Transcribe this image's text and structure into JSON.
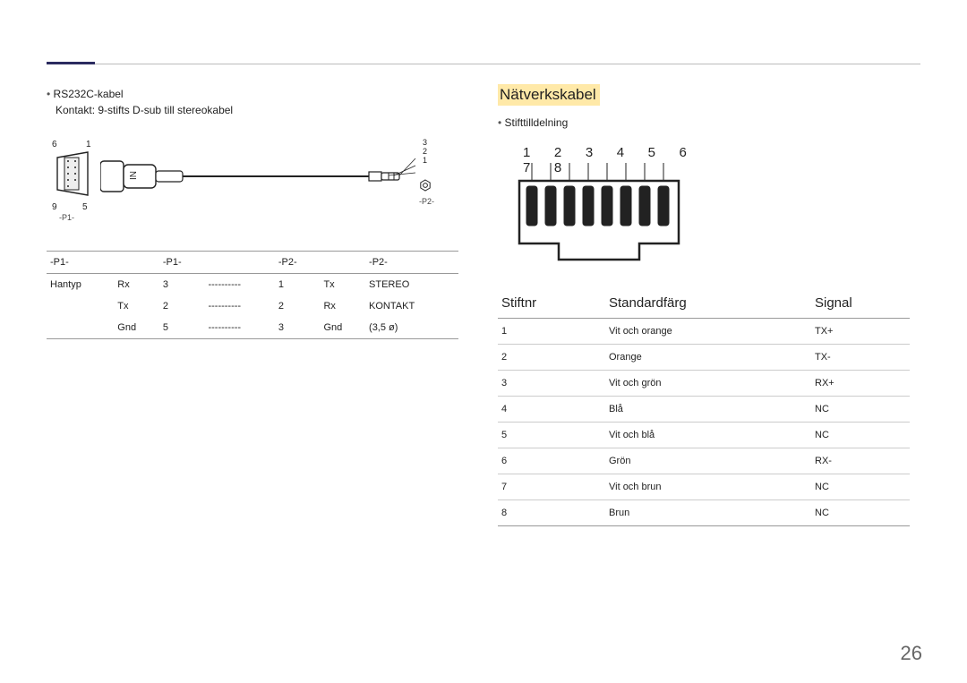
{
  "pageNumber": "26",
  "left": {
    "bullet": "RS232C-kabel",
    "sub": "Kontakt: 9-stifts D-sub till stereokabel",
    "dsub": {
      "tl": "6",
      "tr": "1",
      "bl": "9",
      "br": "5",
      "p1": "-P1-"
    },
    "jack": {
      "l3": "3",
      "l2": "2",
      "l1": "1",
      "p2": "-P2-"
    },
    "tableHeader": [
      "-P1-",
      "-P1-",
      "",
      "-P2-",
      "-P2-",
      ""
    ],
    "tableRows": [
      [
        "Hantyp",
        "Rx",
        "3",
        "----------",
        "1",
        "Tx",
        "STEREO"
      ],
      [
        "",
        "Tx",
        "2",
        "----------",
        "2",
        "Rx",
        "KONTAKT"
      ],
      [
        "",
        "Gnd",
        "5",
        "----------",
        "3",
        "Gnd",
        "(3,5 ø)"
      ]
    ]
  },
  "right": {
    "title": "Nätverkskabel",
    "bullet": "Stifttilldelning",
    "pinNums": "1 2 3 4 5 6 7 8",
    "tableHeader": {
      "c1": "Stiftnr",
      "c2": "Standardfärg",
      "c3": "Signal"
    },
    "rows": [
      {
        "n": "1",
        "color": "Vit och orange",
        "sig": "TX+"
      },
      {
        "n": "2",
        "color": "Orange",
        "sig": "TX-"
      },
      {
        "n": "3",
        "color": "Vit och grön",
        "sig": "RX+"
      },
      {
        "n": "4",
        "color": "Blå",
        "sig": "NC"
      },
      {
        "n": "5",
        "color": "Vit och blå",
        "sig": "NC"
      },
      {
        "n": "6",
        "color": "Grön",
        "sig": "RX-"
      },
      {
        "n": "7",
        "color": "Vit och brun",
        "sig": "NC"
      },
      {
        "n": "8",
        "color": "Brun",
        "sig": "NC"
      }
    ]
  }
}
